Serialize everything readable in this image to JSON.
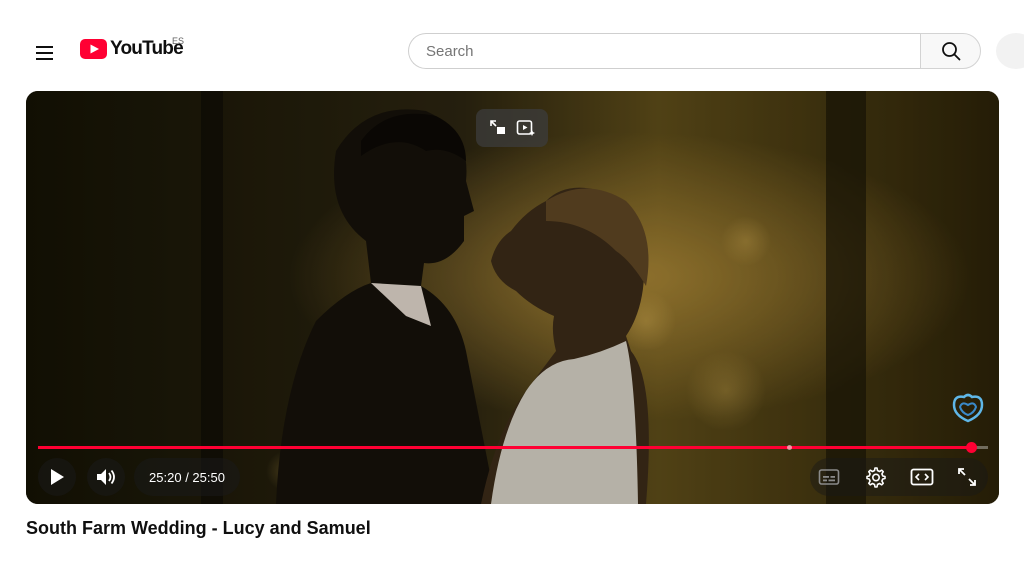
{
  "header": {
    "logo_text": "YouTube",
    "country_code": "ES",
    "search_placeholder": "Search"
  },
  "player": {
    "current_time": "25:20",
    "duration": "25:50",
    "time_display": "25:20 / 25:50",
    "progress_fraction": 0.982,
    "chapter_marks": [
      0.79
    ],
    "accent_color": "#ff0033"
  },
  "video": {
    "title": "South Farm Wedding - Lucy and Samuel"
  },
  "icons": {
    "menu": "hamburger-menu-icon",
    "logo": "youtube-play-logo-icon",
    "search": "search-icon",
    "miniplayer": "miniplayer-icon",
    "autoplay_preview": "play-preview-icon",
    "watermark": "channel-watermark-icon",
    "play": "play-icon",
    "volume": "volume-icon",
    "subtitles": "subtitles-icon",
    "settings": "gear-icon",
    "theater": "theater-mode-icon",
    "fullscreen": "fullscreen-icon"
  }
}
